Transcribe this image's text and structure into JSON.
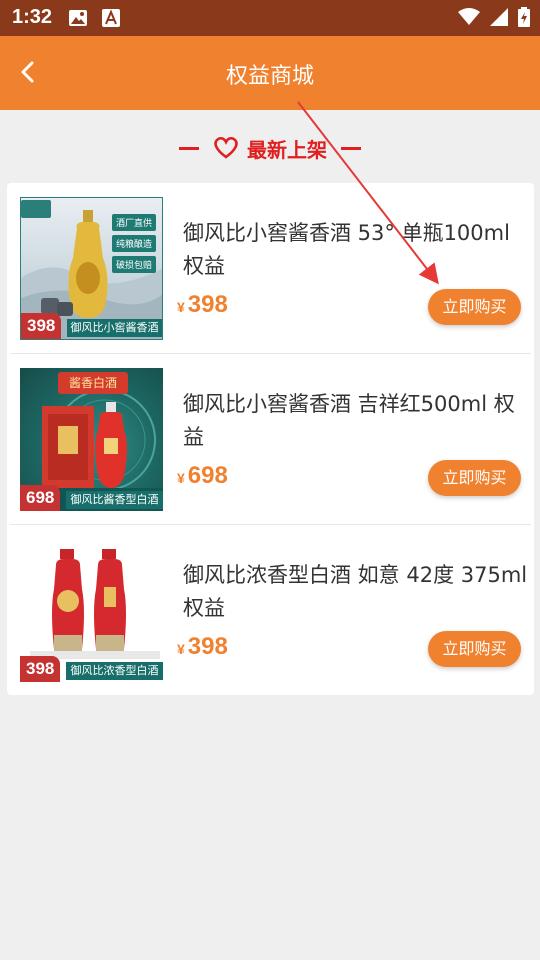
{
  "status_bar": {
    "time": "1:32"
  },
  "header": {
    "title": "权益商城"
  },
  "section": {
    "heading": "最新上架"
  },
  "products": [
    {
      "name": "御风比小窖酱香酒 53° 单瓶100ml 权益",
      "price_symbol": "¥",
      "price": "398",
      "buy_label": "立即购买",
      "image": {
        "price_badge": "398",
        "name_strip": "御风比小窖酱香酒",
        "tags": [
          "酒厂直供",
          "纯粮酿造",
          "破损包赔"
        ]
      }
    },
    {
      "name": "御风比小窖酱香酒 吉祥红500ml 权益",
      "price_symbol": "¥",
      "price": "698",
      "buy_label": "立即购买",
      "image": {
        "price_badge": "698",
        "name_strip": "御风比酱香型白酒",
        "banner": "酱香白酒"
      }
    },
    {
      "name": "御风比浓香型白酒 如意 42度 375ml 权益",
      "price_symbol": "¥",
      "price": "398",
      "buy_label": "立即购买",
      "image": {
        "price_badge": "398",
        "name_strip": "御风比浓香型白酒"
      }
    }
  ],
  "colors": {
    "status_bar": "#8a3a1a",
    "accent": "#f0812f",
    "heading_red": "#e02020",
    "background": "#efefef"
  }
}
